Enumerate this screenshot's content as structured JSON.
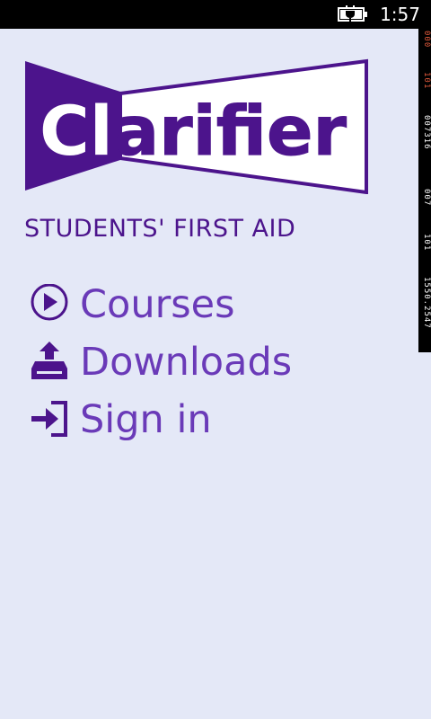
{
  "status_bar": {
    "time": "1:57",
    "battery_icon": "battery-charging-icon"
  },
  "logo": {
    "text": "Clarifier",
    "color": "#4c148c"
  },
  "subtitle": "STUDENTS' FIRST AID",
  "menu": {
    "items": [
      {
        "label": "Courses",
        "icon": "play-circle-icon"
      },
      {
        "label": "Downloads",
        "icon": "download-tray-icon"
      },
      {
        "label": "Sign in",
        "icon": "sign-in-icon"
      }
    ]
  },
  "colors": {
    "background": "#e4e8f7",
    "accent": "#6a3ab8",
    "brand": "#4c148c",
    "debug_red": "#e25a3c"
  },
  "debug_counters": [
    {
      "text": "000",
      "color": "#e25a3c"
    },
    {
      "text": "101",
      "color": "#e25a3c"
    },
    {
      "text": "007316",
      "color": "#ffffff"
    },
    {
      "text": "007",
      "color": "#ffffff"
    },
    {
      "text": "101",
      "color": "#ffffff"
    },
    {
      "text": "1550.2547",
      "color": "#ffffff"
    }
  ]
}
